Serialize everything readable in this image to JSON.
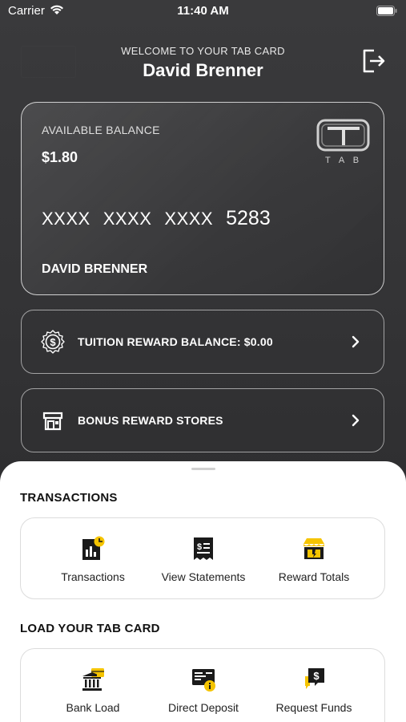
{
  "status_bar": {
    "carrier": "Carrier",
    "time": "11:40 AM"
  },
  "header": {
    "welcome": "WELCOME TO YOUR TAB CARD",
    "name": "David Brenner"
  },
  "card": {
    "balance_label": "AVAILABLE BALANCE",
    "balance_value": "$1.80",
    "number_groups": [
      "XXXX",
      "XXXX",
      "XXXX",
      "5283"
    ],
    "holder": "DAVID BRENNER",
    "logo_text": "T A B"
  },
  "rows": [
    {
      "label": "TUITION REWARD BALANCE: $0.00",
      "icon": "dollar-badge-icon"
    },
    {
      "label": "BONUS REWARD STORES",
      "icon": "store-icon"
    }
  ],
  "transactions": {
    "title": "TRANSACTIONS",
    "actions": [
      {
        "label": "Transactions",
        "icon": "transactions-chart-icon"
      },
      {
        "label": "View Statements",
        "icon": "statement-receipt-icon"
      },
      {
        "label": "Reward Totals",
        "icon": "reward-store-icon"
      }
    ]
  },
  "load": {
    "title": "LOAD YOUR TAB CARD",
    "actions": [
      {
        "label": "Bank Load",
        "icon": "bank-icon"
      },
      {
        "label": "Direct Deposit",
        "icon": "direct-deposit-icon"
      },
      {
        "label": "Request Funds",
        "icon": "request-funds-icon"
      }
    ]
  },
  "colors": {
    "accent": "#f5c400",
    "background_dark": "#333335",
    "sheet": "#ffffff"
  }
}
